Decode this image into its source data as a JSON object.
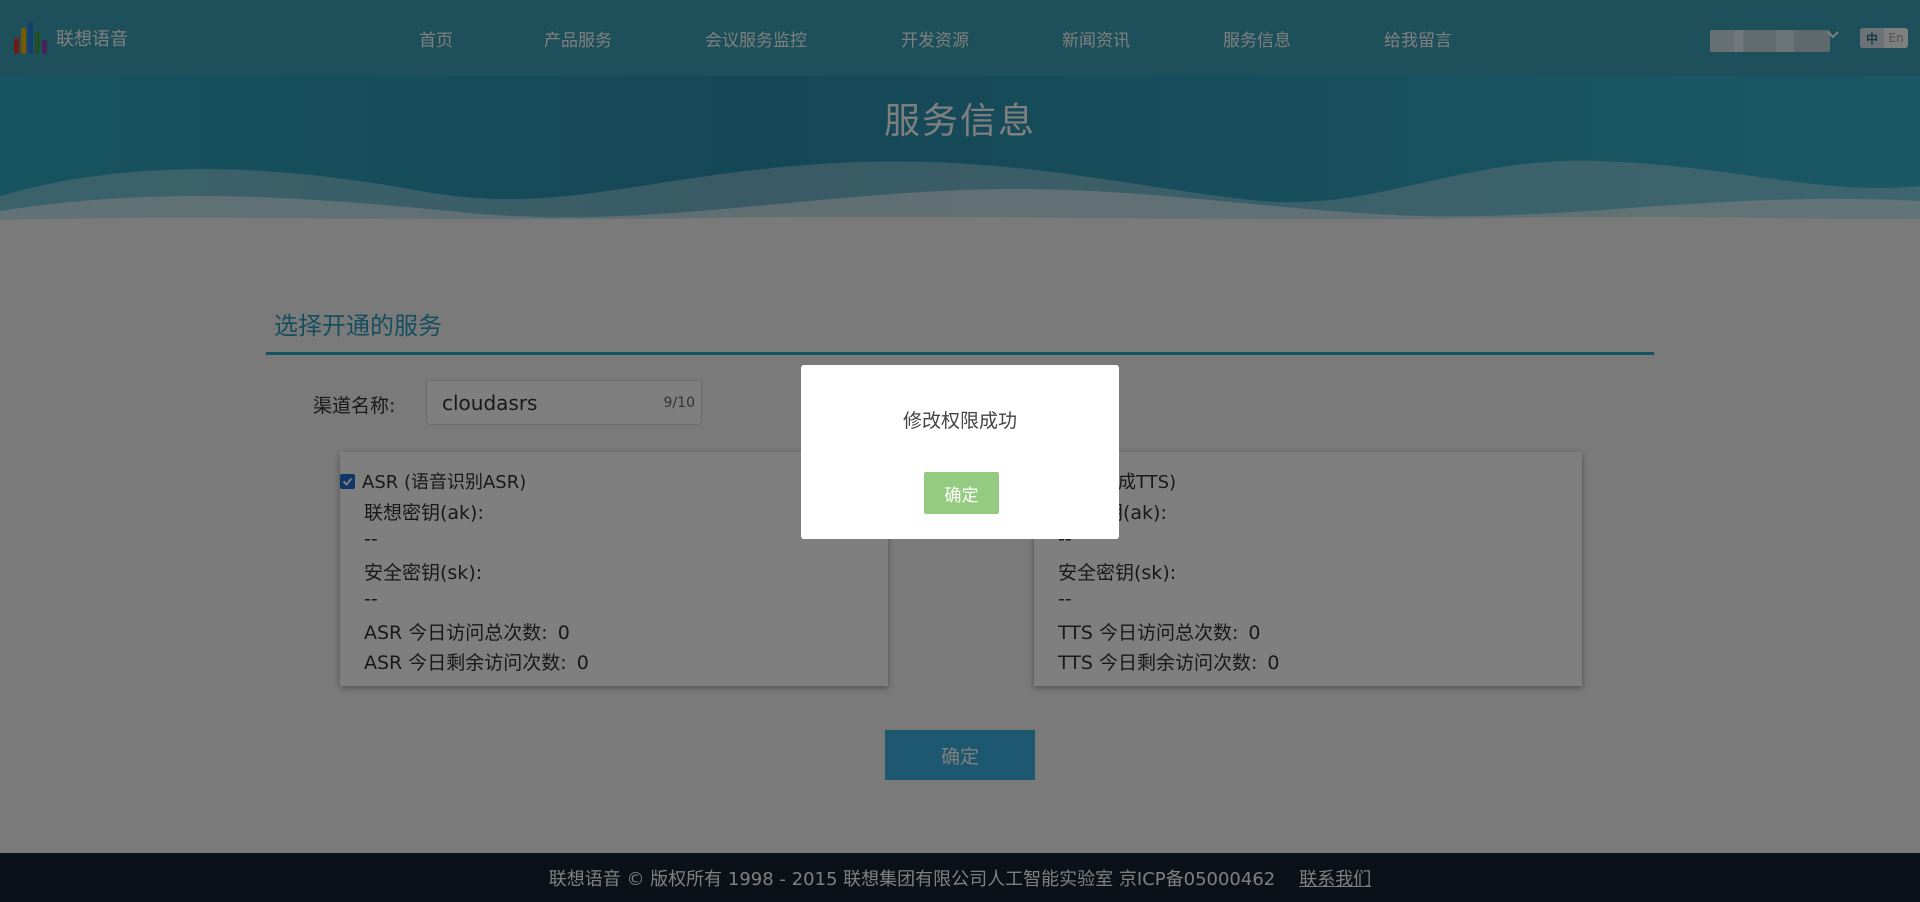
{
  "header": {
    "logo_text": "联想语音",
    "nav": [
      "首页",
      "产品服务",
      "会议服务监控",
      "开发资源",
      "新闻资讯",
      "服务信息",
      "给我留言"
    ],
    "lang": {
      "zh": "中",
      "en": "En"
    }
  },
  "banner": {
    "title": "服务信息"
  },
  "section": {
    "title": "选择开通的服务",
    "channel_label": "渠道名称:",
    "channel_value": "cloudasrs",
    "channel_count": "9/10"
  },
  "cards": {
    "asr": {
      "checkbox_label": "ASR (语音识别ASR)",
      "ak_label": "联想密钥(ak):",
      "ak_value": "--",
      "sk_label": "安全密钥(sk):",
      "sk_value": "--",
      "total_label": "ASR 今日访问总次数:",
      "total_value": "0",
      "remain_label": "ASR 今日剩余访问次数:",
      "remain_value": "0"
    },
    "tts": {
      "checkbox_label": "音合成TTS)",
      "ak_label": "钥(ak):",
      "ak_value": "--",
      "sk_label": "安全密钥(sk):",
      "sk_value": "--",
      "total_label": "TTS 今日访问总次数:",
      "total_value": "0",
      "remain_label": "TTS 今日剩余访问次数:",
      "remain_value": "0"
    }
  },
  "confirm_label": "确定",
  "footer": {
    "copyright": "联想语音 © 版权所有 1998 - 2015 联想集团有限公司人工智能实验室 京ICP备05000462",
    "contact": "联系我们"
  },
  "modal": {
    "message": "修改权限成功",
    "ok_label": "确定"
  },
  "colors": {
    "accent": "#2b9fbd",
    "checkbox": "#1e6fd0",
    "confirm_button": "#3cb0e0",
    "modal_button": "#95cb81",
    "footer_bg": "#142330"
  }
}
